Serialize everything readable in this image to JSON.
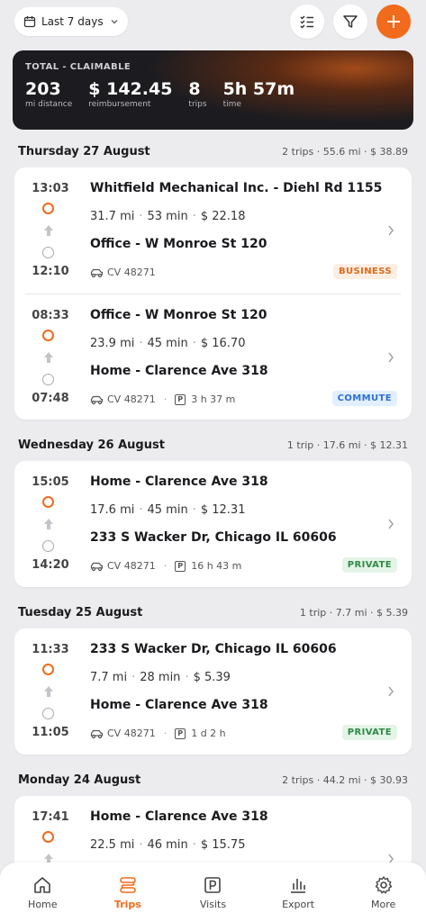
{
  "filter": {
    "range_label": "Last 7 days"
  },
  "summary": {
    "label": "TOTAL - CLAIMABLE",
    "stats": [
      {
        "value": "203",
        "unit": "mi distance"
      },
      {
        "value": "$ 142.45",
        "unit": "reimbursement"
      },
      {
        "value": "8",
        "unit": "trips"
      },
      {
        "value": "5h 57m",
        "unit": "time"
      }
    ]
  },
  "days": [
    {
      "title": "Thursday 27 August",
      "meta": "2 trips · 55.6 mi · $ 38.89",
      "trips": [
        {
          "start": "13:03",
          "end": "12:10",
          "from": "Whitfield Mechanical Inc. - Diehl Rd 1155",
          "distance": "31.7 mi",
          "duration": "53 min",
          "amount": "$ 22.18",
          "to": "Office - W Monroe St 120",
          "vehicle": "CV 48271",
          "parking": "",
          "badge": "BUSINESS",
          "badge_type": "business"
        },
        {
          "start": "08:33",
          "end": "07:48",
          "from": "Office - W Monroe St 120",
          "distance": "23.9 mi",
          "duration": "45 min",
          "amount": "$ 16.70",
          "to": "Home - Clarence Ave 318",
          "vehicle": "CV 48271",
          "parking": "3 h 37 m",
          "badge": "COMMUTE",
          "badge_type": "commute"
        }
      ]
    },
    {
      "title": "Wednesday 26 August",
      "meta": "1 trip · 17.6 mi · $ 12.31",
      "trips": [
        {
          "start": "15:05",
          "end": "14:20",
          "from": "Home - Clarence Ave 318",
          "distance": "17.6 mi",
          "duration": "45 min",
          "amount": "$ 12.31",
          "to": "233 S Wacker Dr, Chicago IL 60606",
          "vehicle": "CV 48271",
          "parking": "16 h 43 m",
          "badge": "PRIVATE",
          "badge_type": "private"
        }
      ]
    },
    {
      "title": "Tuesday 25 August",
      "meta": "1 trip · 7.7 mi · $ 5.39",
      "trips": [
        {
          "start": "11:33",
          "end": "11:05",
          "from": "233 S Wacker Dr, Chicago IL 60606",
          "distance": "7.7 mi",
          "duration": "28 min",
          "amount": "$ 5.39",
          "to": "Home - Clarence Ave 318",
          "vehicle": "CV 48271",
          "parking": "1 d 2 h",
          "badge": "PRIVATE",
          "badge_type": "private"
        }
      ]
    },
    {
      "title": "Monday 24 August",
      "meta": "2 trips · 44.2 mi · $ 30.93",
      "trips": [
        {
          "start": "17:41",
          "end": "",
          "from": "Home - Clarence Ave 318",
          "distance": "22.5 mi",
          "duration": "46 min",
          "amount": "$ 15.75",
          "to": "",
          "vehicle": "",
          "parking": "",
          "badge": "",
          "badge_type": ""
        }
      ]
    }
  ],
  "nav": [
    {
      "label": "Home",
      "icon": "home-icon",
      "active": false
    },
    {
      "label": "Trips",
      "icon": "route-icon",
      "active": true
    },
    {
      "label": "Visits",
      "icon": "parking-icon",
      "active": false
    },
    {
      "label": "Export",
      "icon": "chart-icon",
      "active": false
    },
    {
      "label": "More",
      "icon": "gear-icon",
      "active": false
    }
  ],
  "colors": {
    "accent": "#f26a1b",
    "business": "#e06a1b",
    "commute": "#2c6fd6",
    "private": "#2e8a45"
  }
}
